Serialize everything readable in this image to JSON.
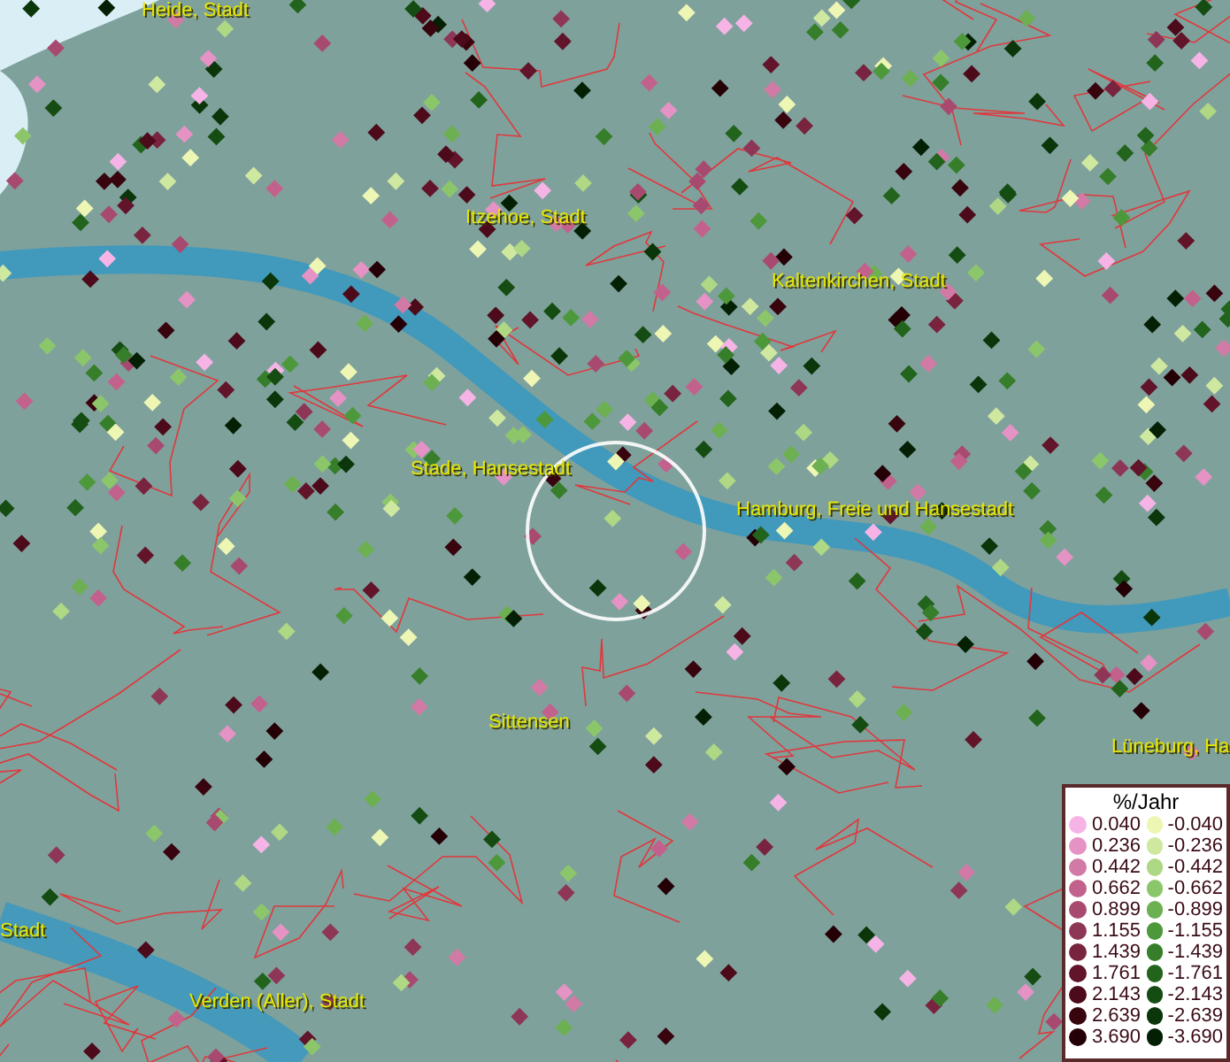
{
  "map_labels": [
    "Heide, Stadt",
    "Itzehoe, Stadt",
    "Kaltenkirchen, Stadt",
    "Stade, Hansestadt",
    "Hamburg, Freie und Hansestadt",
    "Sittensen",
    "Lüneburg, Ha",
    "Stadt",
    "Verden (Aller), Stadt"
  ],
  "legend": {
    "title": "%/Jahr",
    "rows": [
      {
        "positive": {
          "value": "0.040",
          "color": "#f6b4e6"
        },
        "negative": {
          "value": "-0.040",
          "color": "#eef6b4"
        }
      },
      {
        "positive": {
          "value": "0.236",
          "color": "#e592c4"
        },
        "negative": {
          "value": "-0.236",
          "color": "#cfe8a0"
        }
      },
      {
        "positive": {
          "value": "0.442",
          "color": "#d27aa6"
        },
        "negative": {
          "value": "-0.442",
          "color": "#aed884"
        }
      },
      {
        "positive": {
          "value": "0.662",
          "color": "#c2628c"
        },
        "negative": {
          "value": "-0.662",
          "color": "#8cc66a"
        }
      },
      {
        "positive": {
          "value": "0.899",
          "color": "#a84a70"
        },
        "negative": {
          "value": "-0.899",
          "color": "#6cb052"
        }
      },
      {
        "positive": {
          "value": "1.155",
          "color": "#8e3656"
        },
        "negative": {
          "value": "-1.155",
          "color": "#4e983c"
        }
      },
      {
        "positive": {
          "value": "1.439",
          "color": "#78243e"
        },
        "negative": {
          "value": "-1.439",
          "color": "#367e2a"
        }
      },
      {
        "positive": {
          "value": "1.761",
          "color": "#62142a"
        },
        "negative": {
          "value": "-1.761",
          "color": "#22641c"
        }
      },
      {
        "positive": {
          "value": "2.143",
          "color": "#4c0a1a"
        },
        "negative": {
          "value": "-2.143",
          "color": "#144c12"
        }
      },
      {
        "positive": {
          "value": "2.639",
          "color": "#38040e"
        },
        "negative": {
          "value": "-2.639",
          "color": "#0a360a"
        }
      },
      {
        "positive": {
          "value": "3.690",
          "color": "#240006"
        },
        "negative": {
          "value": "-3.690",
          "color": "#042004"
        }
      }
    ]
  }
}
